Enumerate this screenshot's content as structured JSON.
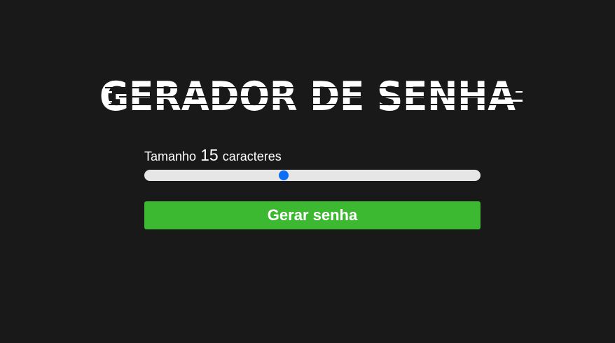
{
  "header": {
    "title": "GERADOR DE SENHA"
  },
  "length_control": {
    "label_prefix": "Tamanho",
    "value": "15",
    "label_suffix": "caracteres",
    "slider_position": 0.415,
    "thumb_color": "#0b6ef5"
  },
  "actions": {
    "generate_label": "Gerar senha",
    "generate_color": "#3cb930"
  },
  "theme": {
    "background": "#191919"
  }
}
